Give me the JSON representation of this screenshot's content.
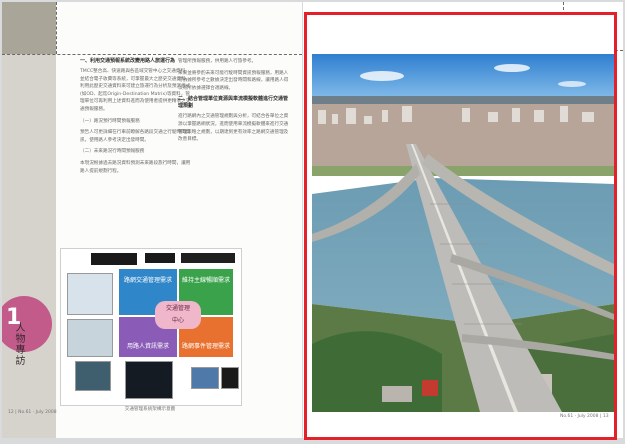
{
  "left_page": {
    "chapter_number": "1",
    "chapter_title": "人物專訪",
    "column_left": {
      "heading": "一、利用交通預報系統改變用路人旅運行為",
      "paragraphs": [
        "TMCC整合高、快速路與各區域交管中心之交通資料，並結合電子收費等系統，可掌握最大之歷史交通資料，利用此歷史交通資料來可建立旅運行為分析及預測模式(如OD、起迄Origin-Destination Matrix)等資料，管理單位可再利用上述資料進而為使用者提供更精準之交通預報服務。",
        "（一）路況預行時間預報服務",
        "預告人可更詳細在行車前瞭解各路段交通之行駛時間資訊，使用路人參考決定出發時間。",
        "（二）未來路況行時間預報服務",
        "本現況根據過去路況資料預測未來路段旅行時間，讓用路人提前規劃行程。"
      ]
    },
    "column_right": {
      "paragraphs": [
        "管理所預報服務，供用路人行旅參考。",
        "未來並將參酌未來可能行駛時間資訊預報服務，用路人可依據所參考之數據決定出發時間和路線，讓用路人得以有所依據選擇合適路線。"
      ],
      "heading": "二、結合管理單位資源與車流模擬軟體進行交通管理規劃",
      "paragraphs_2": [
        "進行路網內之交通管理規劃與分析，可結合各單位之資源以掌握路網狀況，進而使用車流模擬軟體來進行交通管理策略之規劃，以期達到更有效率之路網交通管理及改善目標。"
      ]
    },
    "diagram": {
      "center_label": "交通管理\n中心",
      "q1": "路網交通管理需求",
      "q2": "維持主線暢順需求",
      "q3": "用路人資訊需求",
      "q4": "路網事件管理需求",
      "caption": "交通管理系統架構示意圖"
    },
    "footer": "12 | No.61 · July 2008"
  },
  "right_page": {
    "footer": "No.61 · July 2008 | 13"
  },
  "colors": {
    "frame": "#e4202a",
    "chapter_accent": "#c25a8a",
    "band": "#a9a599"
  }
}
